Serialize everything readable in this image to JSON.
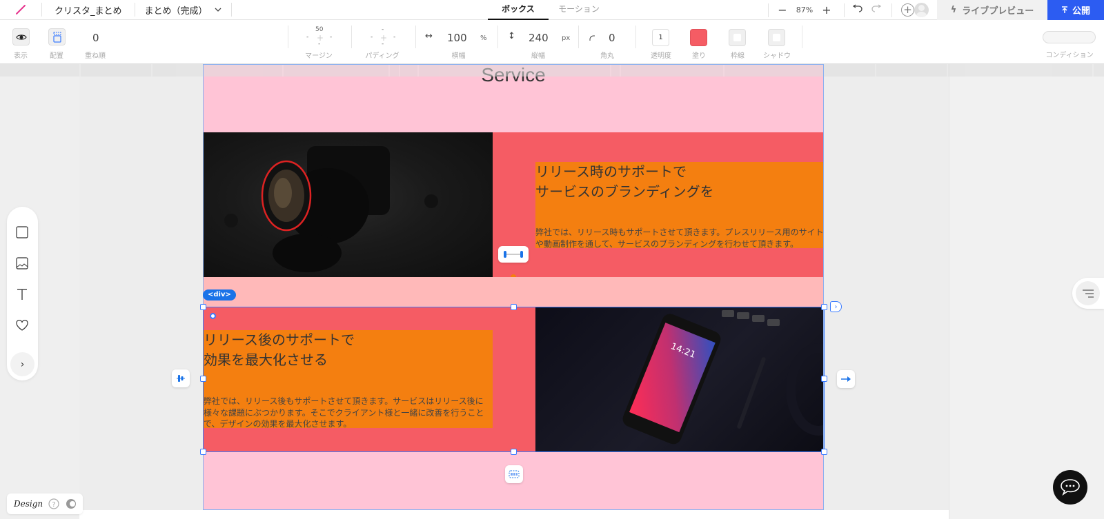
{
  "topbar": {
    "project_name": "クリスタ_まとめ",
    "page_name": "まとめ（完成）",
    "tabs": [
      {
        "label": "ボックス",
        "active": true
      },
      {
        "label": "モーション",
        "active": false
      }
    ],
    "zoom": "87%",
    "zoom_out": "−",
    "zoom_in": "+",
    "live_preview": "ライブプレビュー",
    "publish": "公開",
    "brand_color": "#2c5cf2"
  },
  "properties": {
    "visibility_label": "表示",
    "placement_label": "配置",
    "z_order_value": "0",
    "z_order_label": "重ね順",
    "margin": {
      "top": "50",
      "right": "-",
      "bottom": "-",
      "left": "-",
      "label": "マージン"
    },
    "padding": {
      "top": "-",
      "right": "-",
      "bottom": "-",
      "left": "-",
      "label": "パディング"
    },
    "width": {
      "value": "100",
      "unit": "%",
      "label": "横幅"
    },
    "height": {
      "value": "240",
      "unit": "px",
      "label": "縦幅"
    },
    "radius": {
      "value": "0",
      "label": "角丸"
    },
    "opacity": {
      "value": "1",
      "label": "透明度"
    },
    "fill": {
      "label": "塗り",
      "color": "#f55c64"
    },
    "border_label": "枠線",
    "shadow_label": "シャドウ",
    "condition_label": "コンディション"
  },
  "canvas": {
    "section_title": "Service",
    "section_color": "#ffc4d6",
    "row_color": "#f55c64",
    "text_bg_color": "#f47f10",
    "row1": {
      "title_lines": [
        "リリース時のサポートで",
        "サービスのブランディングを"
      ],
      "description": "弊社では、リリース時もサポートさせて頂きます。プレスリリース用のサイトや動画制作を通して、サービスのブランディングを行わせて頂きます。",
      "image": "camera-photo"
    },
    "row2": {
      "title_lines": [
        "リリース後のサポートで",
        "効果を最大化させる"
      ],
      "description": "弊社では、リリース後もサポートさせて頂きます。サービスはリリース後に様々な課題にぶつかります。そこでクライアント様と一緒に改善を行うことで、デザインの効果を最大化させます。",
      "image": "smartphone-photo",
      "phone_time": "14:21"
    },
    "selection_tag": "<div>"
  },
  "left_toolbar": {
    "items": [
      "box-tool",
      "image-tool",
      "text-tool",
      "icon-tool"
    ],
    "more": "›"
  },
  "footer": {
    "design_logo": "Design"
  }
}
